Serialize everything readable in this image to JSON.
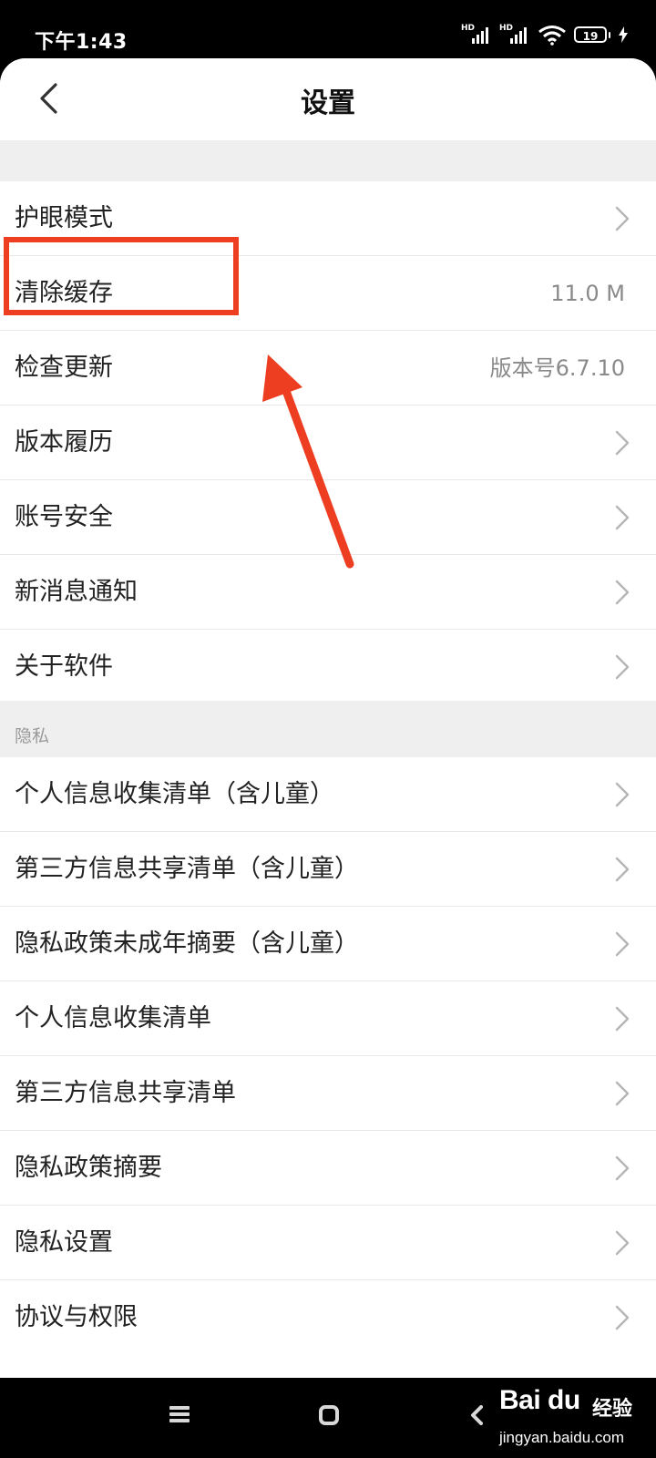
{
  "status_bar": {
    "time": "下午1:43",
    "signal_badge": "HD",
    "battery_level": "19"
  },
  "header": {
    "title": "设置"
  },
  "sections": [
    {
      "items": [
        {
          "label": "护眼模式",
          "value": "",
          "chevron": true
        },
        {
          "label": "清除缓存",
          "value": "11.0 M",
          "chevron": false
        },
        {
          "label": "检查更新",
          "value": "版本号6.7.10",
          "chevron": false
        },
        {
          "label": "版本履历",
          "value": "",
          "chevron": true
        },
        {
          "label": "账号安全",
          "value": "",
          "chevron": true
        },
        {
          "label": "新消息通知",
          "value": "",
          "chevron": true
        },
        {
          "label": "关于软件",
          "value": "",
          "chevron": true
        }
      ]
    },
    {
      "header": "隐私",
      "items": [
        {
          "label": "个人信息收集清单（含儿童）",
          "value": "",
          "chevron": true
        },
        {
          "label": "第三方信息共享清单（含儿童）",
          "value": "",
          "chevron": true
        },
        {
          "label": "隐私政策未成年摘要（含儿童）",
          "value": "",
          "chevron": true
        },
        {
          "label": "个人信息收集清单",
          "value": "",
          "chevron": true
        },
        {
          "label": "第三方信息共享清单",
          "value": "",
          "chevron": true
        },
        {
          "label": "隐私政策摘要",
          "value": "",
          "chevron": true
        },
        {
          "label": "隐私设置",
          "value": "",
          "chevron": true
        },
        {
          "label": "协议与权限",
          "value": "",
          "chevron": true
        }
      ]
    }
  ],
  "watermark": {
    "brand": "Bai du",
    "name": "经验",
    "url": "jingyan.baidu.com"
  },
  "colors": {
    "annotation": "#ee3e22",
    "background_gray": "#efefef",
    "value_text": "#8a8a8a",
    "chevron": "#b5b5b5"
  }
}
